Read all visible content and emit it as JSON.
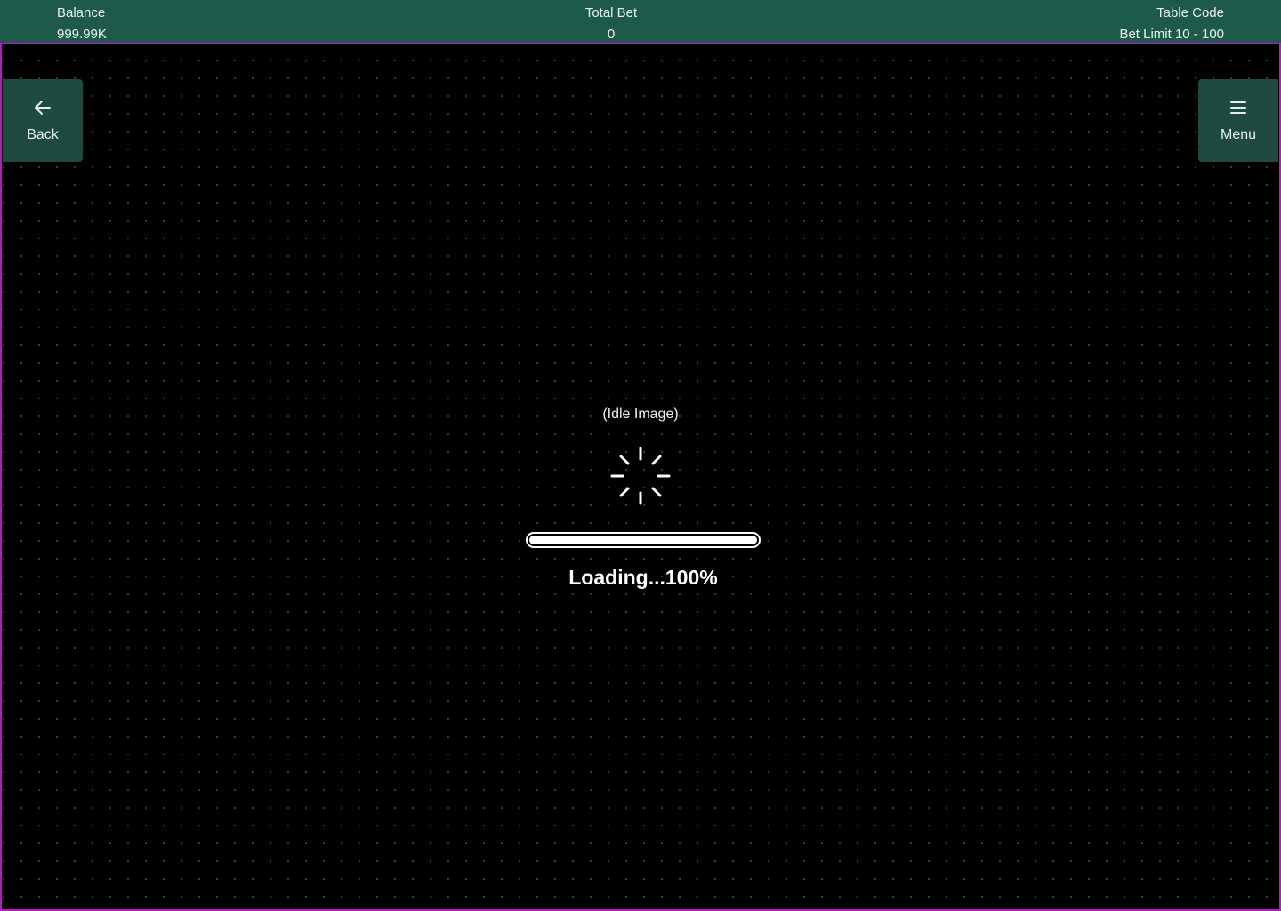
{
  "topbar": {
    "balance_label": "Balance",
    "balance_value": "999.99K",
    "total_bet_label": "Total Bet",
    "total_bet_value": "0",
    "table_code_label": "Table Code",
    "bet_limit": "Bet Limit 10 - 100"
  },
  "nav": {
    "back_label": "Back",
    "back_icon": "arrow-left-icon",
    "menu_label": "Menu",
    "menu_icon": "hamburger-menu-icon"
  },
  "loader": {
    "idle_label": "(Idle Image)",
    "spinner_icon": "loading-spinner-icon",
    "progress_fraction": 1.0,
    "loading_text": "Loading...100%"
  },
  "colors": {
    "topbar_bg": "#1e5a4c",
    "side_button_bg": "#1f4a40",
    "stage_border": "#b11ec0",
    "stage_bg": "#000000"
  }
}
